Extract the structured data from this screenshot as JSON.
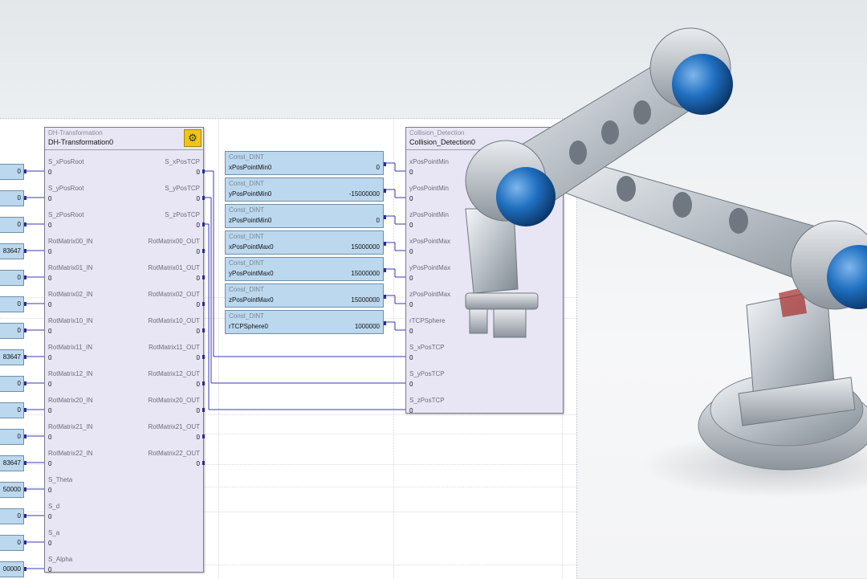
{
  "dh_block": {
    "type": "DH-Transformation",
    "name": "DH-Transformation0",
    "inputs": [
      {
        "label": "S_xPosRoot",
        "value": "0"
      },
      {
        "label": "S_yPosRoot",
        "value": "0"
      },
      {
        "label": "S_zPosRoot",
        "value": "0"
      },
      {
        "label": "RotMatrix00_IN",
        "value": "0"
      },
      {
        "label": "RotMatrix01_IN",
        "value": "0"
      },
      {
        "label": "RotMatrix02_IN",
        "value": "0"
      },
      {
        "label": "RotMatrix10_IN",
        "value": "0"
      },
      {
        "label": "RotMatrix11_IN",
        "value": "0"
      },
      {
        "label": "RotMatrix12_IN",
        "value": "0"
      },
      {
        "label": "RotMatrix20_IN",
        "value": "0"
      },
      {
        "label": "RotMatrix21_IN",
        "value": "0"
      },
      {
        "label": "RotMatrix22_IN",
        "value": "0"
      },
      {
        "label": "S_Theta",
        "value": "0"
      },
      {
        "label": "S_d",
        "value": "0"
      },
      {
        "label": "S_a",
        "value": "0"
      },
      {
        "label": "S_Alpha",
        "value": "0"
      }
    ],
    "outputs": [
      {
        "label": "S_xPosTCP",
        "value": "0"
      },
      {
        "label": "S_yPosTCP",
        "value": "0"
      },
      {
        "label": "S_zPosTCP",
        "value": "0"
      },
      {
        "label": "RotMatrix00_OUT",
        "value": "0"
      },
      {
        "label": "RotMatrix01_OUT",
        "value": "0"
      },
      {
        "label": "RotMatrix02_OUT",
        "value": "0"
      },
      {
        "label": "RotMatrix10_OUT",
        "value": "0"
      },
      {
        "label": "RotMatrix11_OUT",
        "value": "0"
      },
      {
        "label": "RotMatrix12_OUT",
        "value": "0"
      },
      {
        "label": "RotMatrix20_OUT",
        "value": "0"
      },
      {
        "label": "RotMatrix21_OUT",
        "value": "0"
      },
      {
        "label": "RotMatrix22_OUT",
        "value": "0"
      }
    ]
  },
  "constants": [
    {
      "type": "Const_DINT",
      "name": "xPosPointMin0",
      "value": "0"
    },
    {
      "type": "Const_DINT",
      "name": "yPosPointMin0",
      "value": "-15000000"
    },
    {
      "type": "Const_DINT",
      "name": "zPosPointMin0",
      "value": "0"
    },
    {
      "type": "Const_DINT",
      "name": "xPosPointMax0",
      "value": "15000000"
    },
    {
      "type": "Const_DINT",
      "name": "yPosPointMax0",
      "value": "15000000"
    },
    {
      "type": "Const_DINT",
      "name": "zPosPointMax0",
      "value": "15000000"
    },
    {
      "type": "Const_DINT",
      "name": "rTCPSphere0",
      "value": "1000000"
    }
  ],
  "collision_block": {
    "type": "Collision_Detection",
    "name": "Collision_Detection0",
    "inputs": [
      {
        "label": "xPosPointMin",
        "value": "0"
      },
      {
        "label": "yPosPointMin",
        "value": "0"
      },
      {
        "label": "zPosPointMin",
        "value": "0"
      },
      {
        "label": "xPosPointMax",
        "value": "0"
      },
      {
        "label": "yPosPointMax",
        "value": "0"
      },
      {
        "label": "zPosPointMax",
        "value": "0"
      },
      {
        "label": "rTCPSphere",
        "value": "0"
      },
      {
        "label": "S_xPosTCP",
        "value": "0"
      },
      {
        "label": "S_yPosTCP",
        "value": "0"
      },
      {
        "label": "S_zPosTCP",
        "value": "0"
      }
    ]
  },
  "left_inputs": [
    {
      "value": "0"
    },
    {
      "value": "0"
    },
    {
      "value": "0"
    },
    {
      "value": "83647"
    },
    {
      "value": "0"
    },
    {
      "value": "0"
    },
    {
      "value": "0"
    },
    {
      "value": "83647"
    },
    {
      "value": "0"
    },
    {
      "value": "0"
    },
    {
      "value": "0"
    },
    {
      "value": "83647"
    },
    {
      "value": "50000"
    },
    {
      "value": "0"
    },
    {
      "value": "0"
    },
    {
      "value": "00000"
    }
  ],
  "icons": {
    "fb_icon": "robot-arm-icon",
    "illustration": "industrial-robot-arm"
  },
  "colors": {
    "wire": "#3a3ab0",
    "block_fill": "#e8e6f4",
    "const_fill": "#bcd8ee",
    "icon_fill": "#f0c419",
    "robot_joint": "#1f6fc0"
  }
}
